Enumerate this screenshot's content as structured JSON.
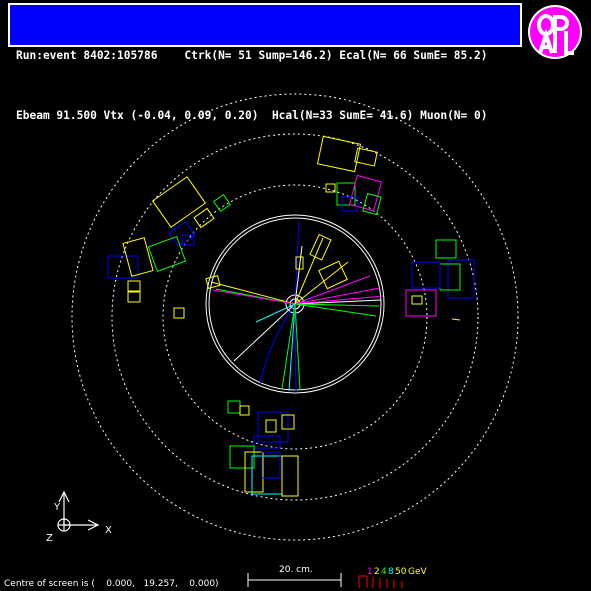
{
  "header": {
    "line1": "Run:event 8402:105786    Ctrk(N= 51 Sump=146.2) Ecal(N= 66 SumE= 85.2)",
    "line2": "Ebeam 91.500 Vtx (-0.04, 0.09, 0.20)  Hcal(N=33 SumE= 41.6) Muon(N= 0)"
  },
  "logo": {
    "text": "OPAL"
  },
  "axes": {
    "y_label": "Y",
    "x_label": "X",
    "z_label": "Z"
  },
  "scale": {
    "label": "20. cm."
  },
  "energy_scale": {
    "values": [
      "1",
      "2",
      "4",
      "8",
      "50"
    ],
    "unit": "GeV"
  },
  "footer": {
    "text": "Centre of screen is (    0.000,   19.257,    0.000)"
  },
  "colors": {
    "header_bg": "#0000ff",
    "detector_lines": "#ffffff",
    "yellow": "#ffff00",
    "green": "#00ff00",
    "blue": "#0000ff",
    "cyan": "#00ffff",
    "magenta": "#ff00ff",
    "red": "#ff0000"
  }
}
